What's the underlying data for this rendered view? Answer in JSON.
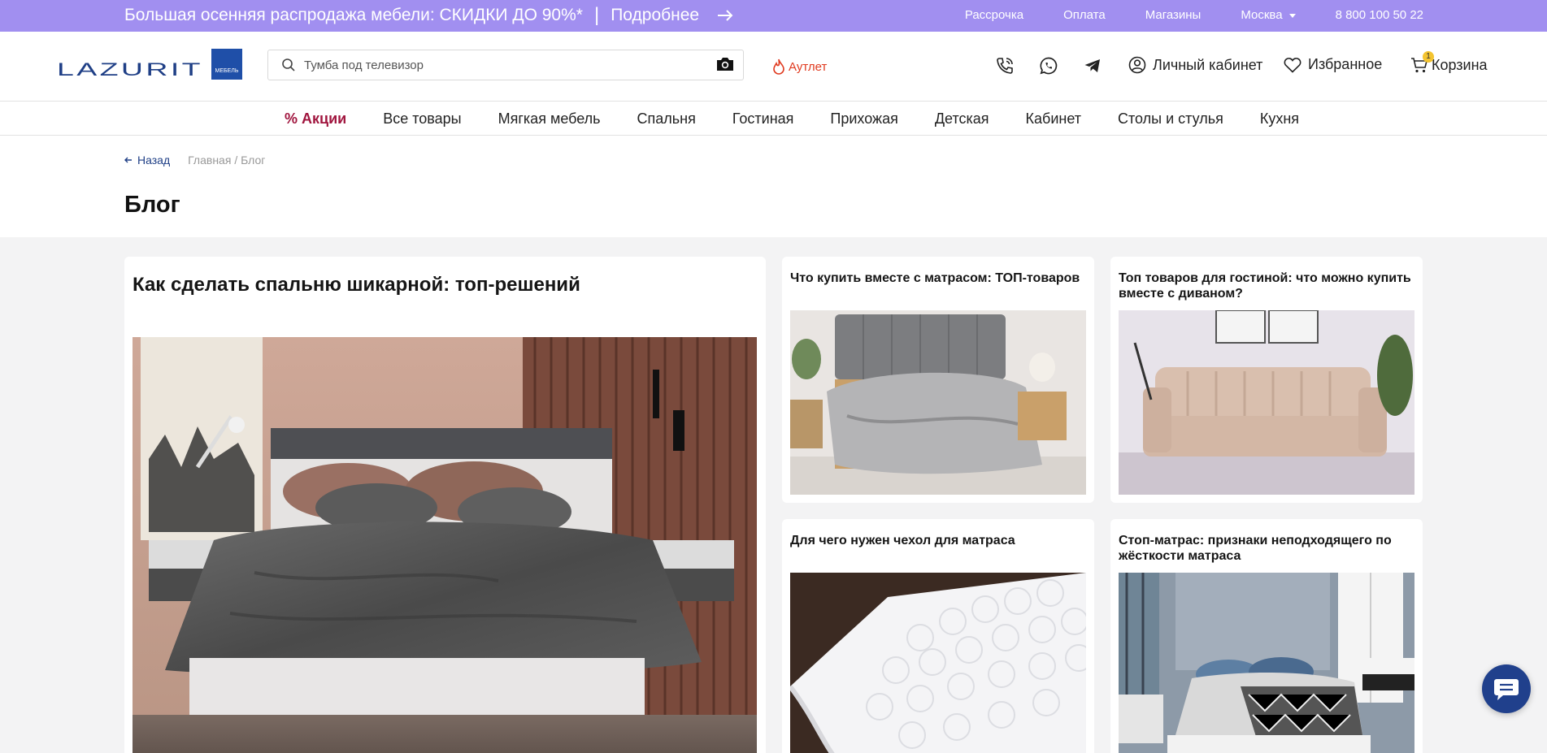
{
  "promo": {
    "text": "Большая осенняя распродажа мебели: СКИДКИ ДО 90%*",
    "more": "Подробнее",
    "links": [
      "Рассрочка",
      "Оплата",
      "Магазины",
      "Москва",
      "8 800 100 50 22"
    ]
  },
  "header": {
    "logo_text": "LAZURIT",
    "logo_badge": "МЕБЕЛЬ",
    "search_placeholder": "Тумба под телевизор",
    "outlet": "Аутлет",
    "account": "Личный кабинет",
    "favorites": "Избранное",
    "cart": "Корзина",
    "cart_count": "1"
  },
  "nav": [
    "% Акции",
    "Все товары",
    "Мягкая мебель",
    "Спальня",
    "Гостиная",
    "Прихожая",
    "Детская",
    "Кабинет",
    "Столы и стулья",
    "Кухня"
  ],
  "breadcrumb": {
    "back": "Назад",
    "home": "Главная",
    "sep": "/",
    "current": "Блог"
  },
  "page_title": "Блог",
  "articles": [
    {
      "title": "Как сделать спальню шикарной: топ-решений",
      "image": "bedroom-grey-bed"
    },
    {
      "title": "Что купить вместе с матрасом: ТОП-товаров",
      "image": "oak-bed-grey-linen"
    },
    {
      "title": "Топ товаров для гостиной: что можно купить вместе с диваном?",
      "image": "beige-sofa"
    },
    {
      "title": "Для чего нужен чехол для матраса",
      "image": "quilted-mattress-cover"
    },
    {
      "title": "Стоп-матрас: признаки неподходящего по жёсткости матраса",
      "image": "bedroom-white-bed-blue-pillows"
    }
  ],
  "colors": {
    "promo_bg": "#a18ff0",
    "brand_blue": "#1f3f86",
    "sale_red": "#a0153e",
    "outlet_red": "#e03a1f",
    "page_bg": "#f3f3f4"
  }
}
